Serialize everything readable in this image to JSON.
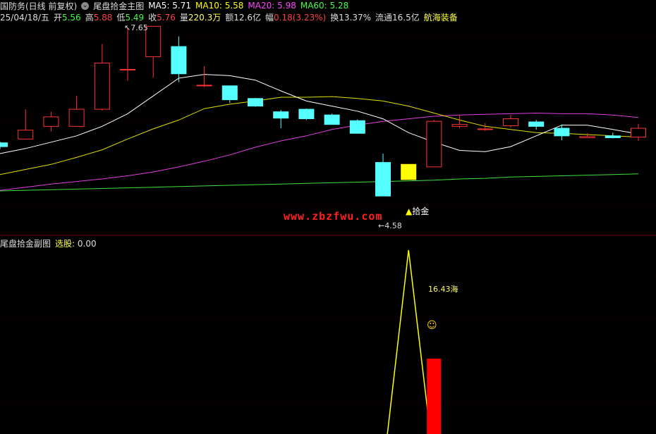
{
  "header": {
    "title": "国防务(日线 前复权)",
    "indicator": "尾盘拾金主图",
    "ma": [
      {
        "label": "MA5:",
        "value": "5.71",
        "color": "#ffffff"
      },
      {
        "label": "MA10:",
        "value": "5.58",
        "color": "#ffff00"
      },
      {
        "label": "MA20:",
        "value": "5.98",
        "color": "#ff00ff"
      },
      {
        "label": "MA60:",
        "value": "5.28",
        "color": "#00ff00"
      }
    ]
  },
  "info_line": {
    "date": "25/04/18/五",
    "open_label": "开",
    "open": "5.56",
    "high_label": "高",
    "high": "5.88",
    "low_label": "低",
    "low": "5.49",
    "close_label": "收",
    "close": "5.76",
    "vol_label": "量",
    "vol": "220.3万",
    "amount_label": "额",
    "amount": "12.6亿",
    "change_label": "幅",
    "change": "0.18(3.23%)",
    "turnover_label": "换",
    "turnover": "13.37%",
    "float_label": "流通",
    "float": "16.5亿",
    "sector": "航海装备"
  },
  "annotations": {
    "high_price": "7.65",
    "low_price": "4.58",
    "signal": "拾金",
    "watermark": "www.zbzfwu.com"
  },
  "sub": {
    "title": "尾盘拾金副图",
    "select_label": "选股:",
    "select_value": "0.00",
    "label_value": "16.43",
    "label_suffix": "海"
  },
  "colors": {
    "up": "#ff3333",
    "down": "#55ffff",
    "signal_bar": "#ffff00",
    "ma5": "#ffffff",
    "ma10": "#e0e000",
    "ma20": "#e040e0",
    "ma60": "#40e040",
    "divider": "#7a0000"
  },
  "chart_data": {
    "type": "candlestick",
    "price_axis": {
      "top_price": 7.65,
      "bottom_price": 4.58
    },
    "candles": [
      {
        "o": 5.84,
        "c": 5.78,
        "h": 5.86,
        "l": 5.74
      },
      {
        "o": 5.9,
        "c": 6.04,
        "h": 6.37,
        "l": 5.9
      },
      {
        "o": 6.1,
        "c": 6.25,
        "h": 6.33,
        "l": 6.02
      },
      {
        "o": 6.1,
        "c": 6.37,
        "h": 6.58,
        "l": 6.1
      },
      {
        "o": 6.37,
        "c": 7.1,
        "h": 7.4,
        "l": 6.35
      },
      {
        "o": 7.0,
        "c": 7.0,
        "h": 7.65,
        "l": 6.82
      },
      {
        "o": 7.2,
        "c": 7.68,
        "h": 7.68,
        "l": 6.87
      },
      {
        "o": 7.36,
        "c": 6.93,
        "h": 7.52,
        "l": 6.8
      },
      {
        "o": 6.75,
        "c": 6.75,
        "h": 7.05,
        "l": 6.72
      },
      {
        "o": 6.74,
        "c": 6.52,
        "h": 6.74,
        "l": 6.47
      },
      {
        "o": 6.54,
        "c": 6.42,
        "h": 6.55,
        "l": 6.41
      },
      {
        "o": 6.33,
        "c": 6.23,
        "h": 6.36,
        "l": 6.07
      },
      {
        "o": 6.37,
        "c": 6.22,
        "h": 6.38,
        "l": 6.2
      },
      {
        "o": 6.28,
        "c": 6.13,
        "h": 6.3,
        "l": 6.13
      },
      {
        "o": 6.19,
        "c": 5.99,
        "h": 6.21,
        "l": 5.99
      },
      {
        "o": 5.53,
        "c": 5.0,
        "h": 5.67,
        "l": 5.0
      },
      {
        "o": 5.5,
        "c": 5.26,
        "h": 5.5,
        "l": 5.26
      },
      {
        "o": 5.46,
        "c": 6.18,
        "h": 6.2,
        "l": 5.46
      },
      {
        "o": 6.1,
        "c": 6.13,
        "h": 6.28,
        "l": 6.07
      },
      {
        "o": 6.05,
        "c": 6.06,
        "h": 6.15,
        "l": 6.03
      },
      {
        "o": 6.11,
        "c": 6.22,
        "h": 6.28,
        "l": 6.08
      },
      {
        "o": 6.17,
        "c": 6.1,
        "h": 6.2,
        "l": 6.05
      },
      {
        "o": 6.07,
        "c": 5.95,
        "h": 6.13,
        "l": 5.88
      },
      {
        "o": 5.92,
        "c": 5.94,
        "h": 5.99,
        "l": 5.92
      },
      {
        "o": 5.95,
        "c": 5.92,
        "h": 6.0,
        "l": 5.91
      },
      {
        "o": 5.93,
        "c": 6.07,
        "h": 6.14,
        "l": 5.87
      }
    ],
    "signal_index": 16,
    "ma5": [
      5.67,
      5.75,
      5.85,
      5.95,
      6.1,
      6.3,
      6.58,
      6.86,
      6.92,
      6.9,
      6.83,
      6.66,
      6.5,
      6.42,
      6.34,
      6.22,
      6.0,
      5.85,
      5.72,
      5.7,
      5.78,
      5.95,
      6.12,
      6.12,
      6.05,
      5.98
    ],
    "ma10": [
      5.34,
      5.42,
      5.5,
      5.61,
      5.73,
      5.9,
      6.06,
      6.2,
      6.38,
      6.45,
      6.5,
      6.56,
      6.56,
      6.57,
      6.54,
      6.5,
      6.42,
      6.31,
      6.2,
      6.1,
      6.05,
      6.0,
      5.99,
      5.97,
      5.95,
      5.93
    ],
    "ma20": [
      5.09,
      5.14,
      5.19,
      5.23,
      5.27,
      5.32,
      5.38,
      5.46,
      5.55,
      5.65,
      5.77,
      5.87,
      5.95,
      6.05,
      6.12,
      6.18,
      6.22,
      6.26,
      6.28,
      6.29,
      6.3,
      6.31,
      6.3,
      6.3,
      6.28,
      6.24
    ],
    "ma60": [
      5.08,
      5.09,
      5.1,
      5.11,
      5.12,
      5.13,
      5.14,
      5.15,
      5.16,
      5.17,
      5.18,
      5.19,
      5.2,
      5.21,
      5.22,
      5.23,
      5.24,
      5.25,
      5.27,
      5.28,
      5.3,
      5.31,
      5.32,
      5.33,
      5.34,
      5.35
    ]
  }
}
